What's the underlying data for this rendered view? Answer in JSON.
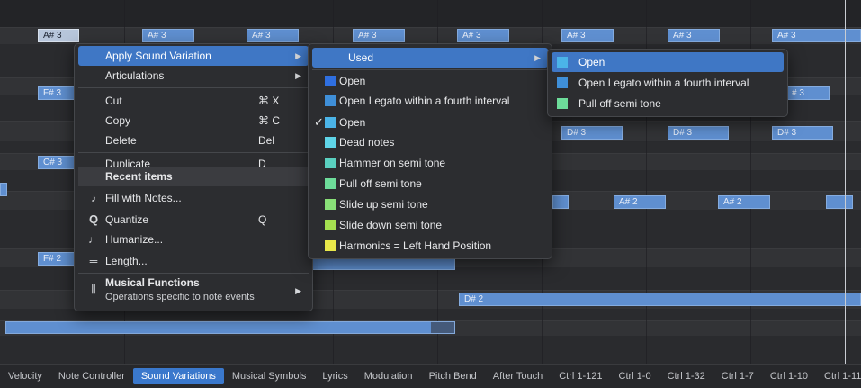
{
  "notes": [
    {
      "label": "A# 3",
      "selected": true
    },
    {
      "label": "A# 3"
    },
    {
      "label": "A# 3"
    },
    {
      "label": "A# 3"
    },
    {
      "label": "A# 3"
    },
    {
      "label": "A# 3"
    },
    {
      "label": "A# 3"
    },
    {
      "label": "A# 3"
    },
    {
      "label": "F# 3"
    },
    {
      "label": "# 3"
    },
    {
      "label": "D# 3"
    },
    {
      "label": "D# 3"
    },
    {
      "label": "D# 3"
    },
    {
      "label": "C# 3"
    },
    {
      "label": "A# 2"
    },
    {
      "label": "A# 2"
    },
    {
      "label": "F# 2"
    },
    {
      "label": "D# 2"
    }
  ],
  "context_menu": {
    "apply_sound_variation": "Apply Sound Variation",
    "articulations": "Articulations",
    "cut": "Cut",
    "cut_shortcut": "⌘ X",
    "copy": "Copy",
    "copy_shortcut": "⌘ C",
    "delete": "Delete",
    "delete_shortcut": "Del",
    "duplicate": "Duplicate",
    "duplicate_shortcut": "D",
    "recent_items": "Recent items",
    "fill_with_notes": "Fill with Notes...",
    "quantize": "Quantize",
    "quantize_shortcut": "Q",
    "humanize": "Humanize...",
    "length": "Length...",
    "musical_functions": "Musical Functions",
    "musical_functions_sub": "Operations specific to note events"
  },
  "sound_variation_menu": {
    "used": "Used",
    "items": [
      {
        "label": "Open",
        "color": "#2f6fe0",
        "checked": false
      },
      {
        "label": "Open Legato within a fourth interval",
        "color": "#3f8fd8",
        "checked": false
      },
      {
        "label": "Open",
        "color": "#4bb4e8",
        "checked": true
      },
      {
        "label": "Dead notes",
        "color": "#5fd5e8",
        "checked": false
      },
      {
        "label": "Hammer on semi tone",
        "color": "#5ad0c0",
        "checked": false
      },
      {
        "label": "Pull off semi tone",
        "color": "#6ddc9a",
        "checked": false
      },
      {
        "label": "Slide up semi tone",
        "color": "#89e078",
        "checked": false
      },
      {
        "label": "Slide down semi tone",
        "color": "#a5e050",
        "checked": false
      },
      {
        "label": "Harmonics = Left Hand Position",
        "color": "#e8e84a",
        "checked": false
      }
    ]
  },
  "used_menu": {
    "items": [
      {
        "label": "Open",
        "color": "#4bb4e8"
      },
      {
        "label": "Open Legato within a fourth interval",
        "color": "#3f8fd8"
      },
      {
        "label": "Pull off semi tone",
        "color": "#6ddc9a"
      }
    ]
  },
  "tabs": [
    "Velocity",
    "Note Controller",
    "Sound Variations",
    "Musical Symbols",
    "Lyrics",
    "Modulation",
    "Pitch Bend",
    "After Touch",
    "Ctrl 1-121",
    "Ctrl 1-0",
    "Ctrl 1-32",
    "Ctrl 1-7",
    "Ctrl 1-10",
    "Ctrl 1-11"
  ],
  "active_tab": "Sound Variations"
}
